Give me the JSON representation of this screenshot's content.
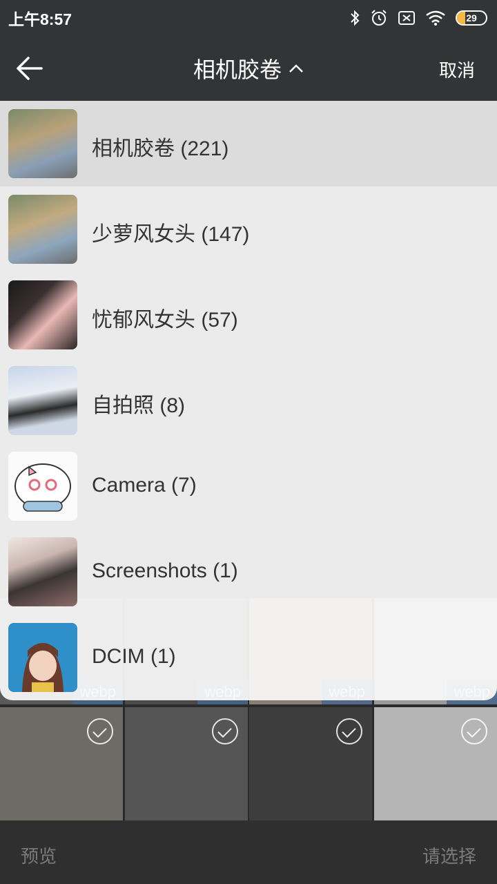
{
  "status_bar": {
    "time": "上午8:57",
    "battery_level": "29",
    "icons": [
      "bluetooth-icon",
      "alarm-icon",
      "sim-off-icon",
      "wifi-icon",
      "battery-icon"
    ]
  },
  "header": {
    "title": "相机胶卷",
    "cancel_label": "取消",
    "back_icon": "arrow-left-icon",
    "expand_icon": "chevron-up-icon"
  },
  "albums": [
    {
      "label": "相机胶卷 (221)",
      "selected": true
    },
    {
      "label": "少萝风女头 (147)",
      "selected": false
    },
    {
      "label": "忧郁风女头 (57)",
      "selected": false
    },
    {
      "label": "自拍照 (8)",
      "selected": false
    },
    {
      "label": "Camera (7)",
      "selected": false
    },
    {
      "label": "Screenshots (1)",
      "selected": false
    },
    {
      "label": "DCIM (1)",
      "selected": false
    }
  ],
  "grid": {
    "webp_label": "webp"
  },
  "bottom_bar": {
    "preview_label": "预览",
    "select_label": "请选择"
  },
  "colors": {
    "bar_background": "#333435",
    "accent_battery": "#f5b942",
    "panel_background": "#fafafa",
    "disabled_text": "#7a7a7a"
  }
}
